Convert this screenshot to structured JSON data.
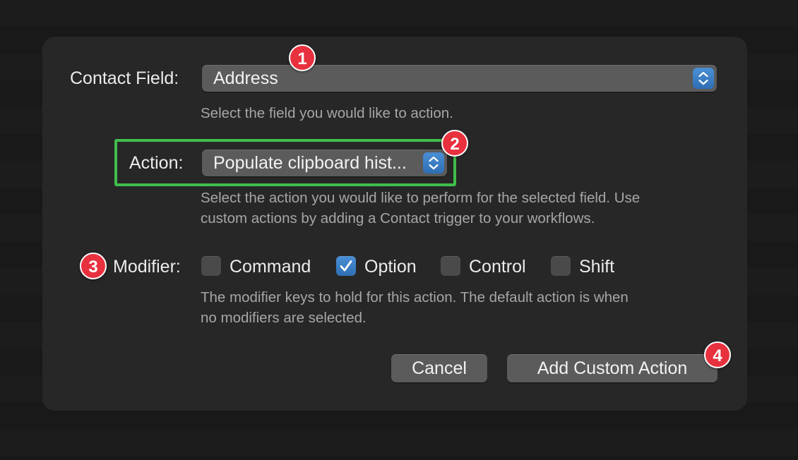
{
  "contact_field": {
    "label": "Contact Field:",
    "value": "Address",
    "help": "Select the field you would like to action."
  },
  "action": {
    "label": "Action:",
    "value": "Populate clipboard hist...",
    "help_line1": "Select the action you would like to perform for the selected field. Use",
    "help_line2": "custom actions by adding a Contact trigger to your workflows."
  },
  "modifier": {
    "label": "Modifier:",
    "options": [
      {
        "label": "Command",
        "checked": false
      },
      {
        "label": "Option",
        "checked": true
      },
      {
        "label": "Control",
        "checked": false
      },
      {
        "label": "Shift",
        "checked": false
      }
    ],
    "help_line1": "The modifier keys to hold for this action. The default action is when",
    "help_line2": "no modifiers are selected."
  },
  "buttons": {
    "cancel": "Cancel",
    "add": "Add Custom Action"
  },
  "badges": [
    "1",
    "2",
    "3",
    "4"
  ],
  "colors": {
    "accent": "#3f82c8",
    "badge": "#e8313e",
    "highlight": "#3fbe4c"
  }
}
